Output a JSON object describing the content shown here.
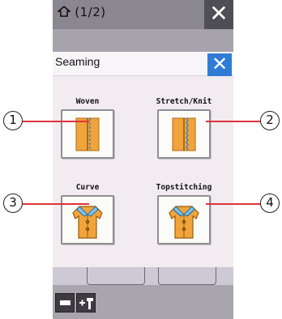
{
  "header": {
    "page_indicator": "(1/2)",
    "close_glyph": "✕"
  },
  "dialog": {
    "title": "Seaming",
    "close_glyph": "✕",
    "options": [
      {
        "label": "Woven",
        "callout": "1"
      },
      {
        "label": "Stretch/Knit",
        "callout": "2"
      },
      {
        "label": "Curve",
        "callout": "3"
      },
      {
        "label": "Topstitching",
        "callout": "4"
      }
    ]
  },
  "colors": {
    "accent": "#2f7cd6",
    "fabric": "#f1a43b",
    "leader": "#e0323a",
    "collar": "#7fc3ea"
  }
}
